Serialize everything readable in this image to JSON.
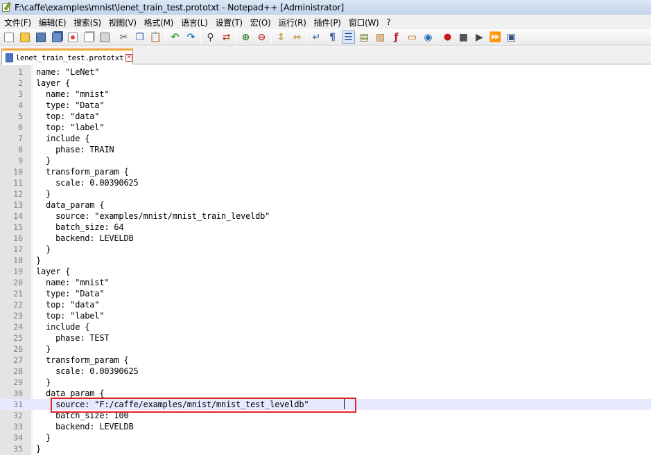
{
  "window": {
    "title": "F:\\caffe\\examples\\mnist\\lenet_train_test.prototxt - Notepad++ [Administrator]"
  },
  "menu": [
    "文件(F)",
    "编辑(E)",
    "搜索(S)",
    "视图(V)",
    "格式(M)",
    "语言(L)",
    "设置(T)",
    "宏(O)",
    "运行(R)",
    "插件(P)",
    "窗口(W)",
    "?"
  ],
  "toolbar": {
    "icons": [
      "new-file-icon",
      "open-file-icon",
      "save-icon",
      "save-all-icon",
      "close-icon",
      "close-all-icon",
      "print-icon",
      "cut-icon",
      "copy-icon",
      "paste-icon",
      "undo-icon",
      "redo-icon",
      "find-icon",
      "replace-icon",
      "zoom-in-icon",
      "zoom-out-icon",
      "sync-scroll-icon",
      "word-wrap-icon",
      "show-all-chars-icon",
      "indent-guide-icon",
      "user-language-icon",
      "document-map-icon",
      "function-list-icon",
      "folder-workspace-icon",
      "monitoring-eye-icon",
      "record-macro-icon",
      "stop-macro-icon",
      "play-macro-icon",
      "play-macro-multiple-icon",
      "save-macro-icon"
    ]
  },
  "tab": {
    "label": "lenet_train_test.prototxt",
    "close_glyph": "✕"
  },
  "editor": {
    "current_line": 31,
    "lines": [
      "name: \"LeNet\"",
      "layer {",
      "  name: \"mnist\"",
      "  type: \"Data\"",
      "  top: \"data\"",
      "  top: \"label\"",
      "  include {",
      "    phase: TRAIN",
      "  }",
      "  transform_param {",
      "    scale: 0.00390625",
      "  }",
      "  data_param {",
      "    source: \"examples/mnist/mnist_train_leveldb\"",
      "    batch_size: 64",
      "    backend: LEVELDB",
      "  }",
      "}",
      "layer {",
      "  name: \"mnist\"",
      "  type: \"Data\"",
      "  top: \"data\"",
      "  top: \"label\"",
      "  include {",
      "    phase: TEST",
      "  }",
      "  transform_param {",
      "    scale: 0.00390625",
      "  }",
      "  data_param {",
      "    source: \"F:/caffe/examples/mnist/mnist_test_leveldb\"",
      "    batch_size: 100",
      "    backend: LEVELDB",
      "  }",
      "}"
    ]
  },
  "colors": {
    "annotation_box": "#e02525",
    "active_tab_accent": "#f8a63a",
    "current_line_bg": "#e8e8ff",
    "gutter_bg": "#e4e4e4"
  }
}
